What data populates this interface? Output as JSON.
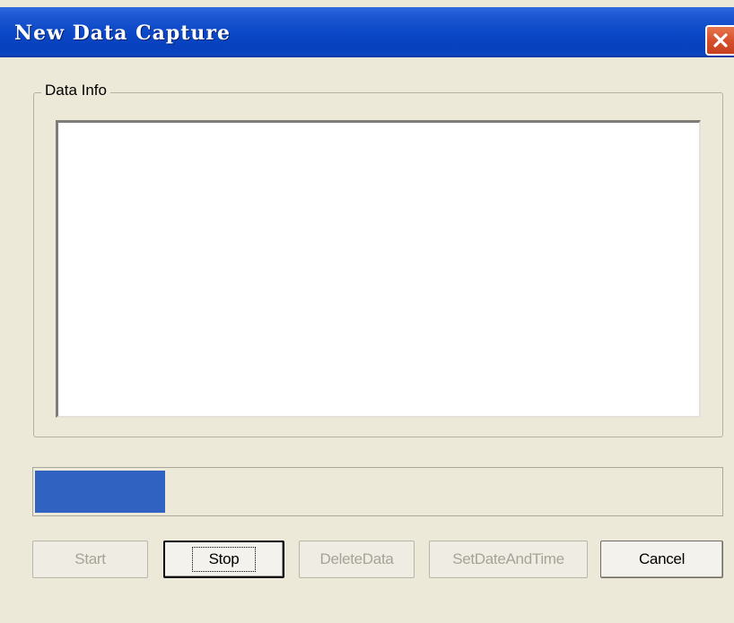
{
  "window": {
    "title": "New Data Capture",
    "close_icon": "close-x-icon"
  },
  "group": {
    "label": "Data Info",
    "text_value": ""
  },
  "progress": {
    "percent": 19
  },
  "buttons": {
    "start": "Start",
    "stop": "Stop",
    "delete": "DeleteData",
    "set_date": "SetDateAndTime",
    "cancel": "Cancel"
  },
  "colors": {
    "title_bar": "#0A47C6",
    "close_button": "#D6502C",
    "progress_fill": "#3062C1",
    "dialog_bg": "#ECE9D8"
  }
}
